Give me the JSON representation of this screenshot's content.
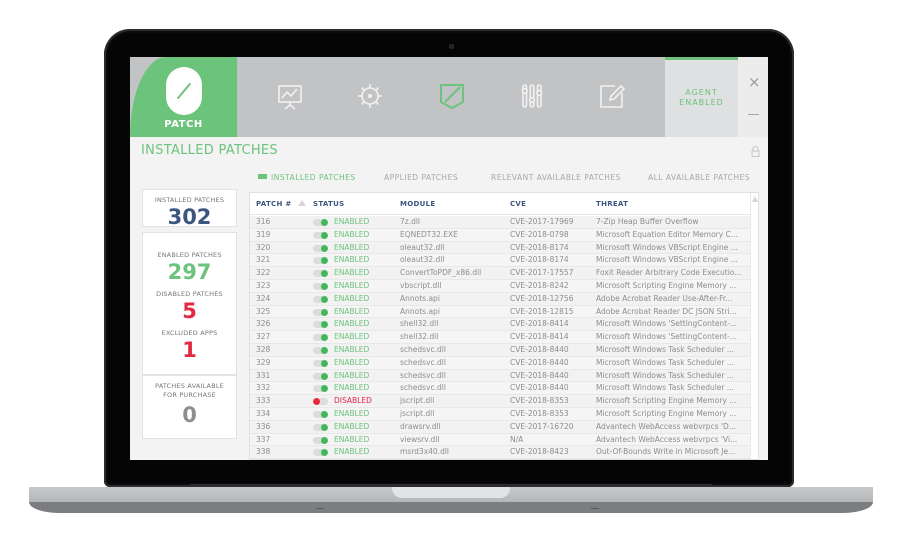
{
  "app": {
    "brand_label": "PATCH",
    "nav_icons": [
      "presentation-chart-icon",
      "gear-icon",
      "shield-icon",
      "sliders-icon",
      "edit-icon"
    ],
    "active_nav": "shield-icon",
    "agent_status_line1": "AGENT",
    "agent_status_line2": "ENABLED",
    "close_glyph": "×"
  },
  "page": {
    "title": "INSTALLED PATCHES",
    "tabs": [
      {
        "label": "INSTALLED PATCHES",
        "active": true
      },
      {
        "label": "APPLIED PATCHES",
        "active": false
      },
      {
        "label": "RELEVANT AVAILABLE PATCHES",
        "active": false
      },
      {
        "label": "ALL AVAILABLE PATCHES",
        "active": false
      }
    ]
  },
  "stats": {
    "installed": {
      "label": "INSTALLED PATCHES",
      "value": "302",
      "color": "#3d567f"
    },
    "enabled": {
      "label": "ENABLED PATCHES",
      "value": "297",
      "color": "#6cc37c"
    },
    "disabled": {
      "label": "DISABLED PATCHES",
      "value": "5",
      "color": "#e22a42"
    },
    "excluded": {
      "label": "EXCLUDED APPS",
      "value": "1",
      "color": "#e22a42"
    },
    "purchase": {
      "label1": "PATCHES AVAILABLE",
      "label2": "FOR PURCHASE",
      "value": "0",
      "color": "#8d8d8d"
    }
  },
  "table": {
    "columns": [
      "PATCH #",
      "STATUS",
      "MODULE",
      "CVE",
      "THREAT"
    ],
    "rows": [
      {
        "patch": "316",
        "enabled": true,
        "status": "ENABLED",
        "module": "7z.dll",
        "cve": "CVE-2017-17969",
        "threat": "7-Zip Heap Buffer Overflow"
      },
      {
        "patch": "319",
        "enabled": true,
        "status": "ENABLED",
        "module": "EQNEDT32.EXE",
        "cve": "CVE-2018-0798",
        "threat": "Microsoft Equation Editor Memory C..."
      },
      {
        "patch": "320",
        "enabled": true,
        "status": "ENABLED",
        "module": "oleaut32.dll",
        "cve": "CVE-2018-8174",
        "threat": "Microsoft Windows VBScript Engine ..."
      },
      {
        "patch": "321",
        "enabled": true,
        "status": "ENABLED",
        "module": "oleaut32.dll",
        "cve": "CVE-2018-8174",
        "threat": "Microsoft Windows VBScript Engine ..."
      },
      {
        "patch": "322",
        "enabled": true,
        "status": "ENABLED",
        "module": "ConvertToPDF_x86.dll",
        "cve": "CVE-2017-17557",
        "threat": "Foxit Reader Arbitrary Code Executio..."
      },
      {
        "patch": "323",
        "enabled": true,
        "status": "ENABLED",
        "module": "vbscript.dll",
        "cve": "CVE-2018-8242",
        "threat": "Microsoft Scripting Engine Memory ..."
      },
      {
        "patch": "324",
        "enabled": true,
        "status": "ENABLED",
        "module": "Annots.api",
        "cve": "CVE-2018-12756",
        "threat": "Adobe Acrobat Reader Use-After-Fr..."
      },
      {
        "patch": "325",
        "enabled": true,
        "status": "ENABLED",
        "module": "Annots.api",
        "cve": "CVE-2018-12815",
        "threat": "Adobe Acrobat Reader DC JSON Stri..."
      },
      {
        "patch": "326",
        "enabled": true,
        "status": "ENABLED",
        "module": "shell32.dll",
        "cve": "CVE-2018-8414",
        "threat": "Microsoft Windows 'SettingContent-..."
      },
      {
        "patch": "327",
        "enabled": true,
        "status": "ENABLED",
        "module": "shell32.dll",
        "cve": "CVE-2018-8414",
        "threat": "Microsoft Windows 'SettingContent-..."
      },
      {
        "patch": "328",
        "enabled": true,
        "status": "ENABLED",
        "module": "schedsvc.dll",
        "cve": "CVE-2018-8440",
        "threat": "Microsoft Windows Task Scheduler ..."
      },
      {
        "patch": "329",
        "enabled": true,
        "status": "ENABLED",
        "module": "schedsvc.dll",
        "cve": "CVE-2018-8440",
        "threat": "Microsoft Windows Task Scheduler ..."
      },
      {
        "patch": "331",
        "enabled": true,
        "status": "ENABLED",
        "module": "schedsvc.dll",
        "cve": "CVE-2018-8440",
        "threat": "Microsoft Windows Task Scheduler ..."
      },
      {
        "patch": "332",
        "enabled": true,
        "status": "ENABLED",
        "module": "schedsvc.dll",
        "cve": "CVE-2018-8440",
        "threat": "Microsoft Windows Task Scheduler ..."
      },
      {
        "patch": "333",
        "enabled": false,
        "status": "DISABLED",
        "module": "jscript.dll",
        "cve": "CVE-2018-8353",
        "threat": "Microsoft Scripting Engine Memory ..."
      },
      {
        "patch": "334",
        "enabled": true,
        "status": "ENABLED",
        "module": "jscript.dll",
        "cve": "CVE-2018-8353",
        "threat": "Microsoft Scripting Engine Memory ..."
      },
      {
        "patch": "336",
        "enabled": true,
        "status": "ENABLED",
        "module": "drawsrv.dll",
        "cve": "CVE-2017-16720",
        "threat": "Advantech WebAccess webvrpcs 'D..."
      },
      {
        "patch": "337",
        "enabled": true,
        "status": "ENABLED",
        "module": "viewsrv.dll",
        "cve": "N/A",
        "threat": "Advantech WebAccess webvrpcs 'Vi..."
      },
      {
        "patch": "338",
        "enabled": true,
        "status": "ENABLED",
        "module": "msrd3x40.dll",
        "cve": "CVE-2018-8423",
        "threat": "Out-Of-Bounds Write in Microsoft Je..."
      }
    ]
  }
}
